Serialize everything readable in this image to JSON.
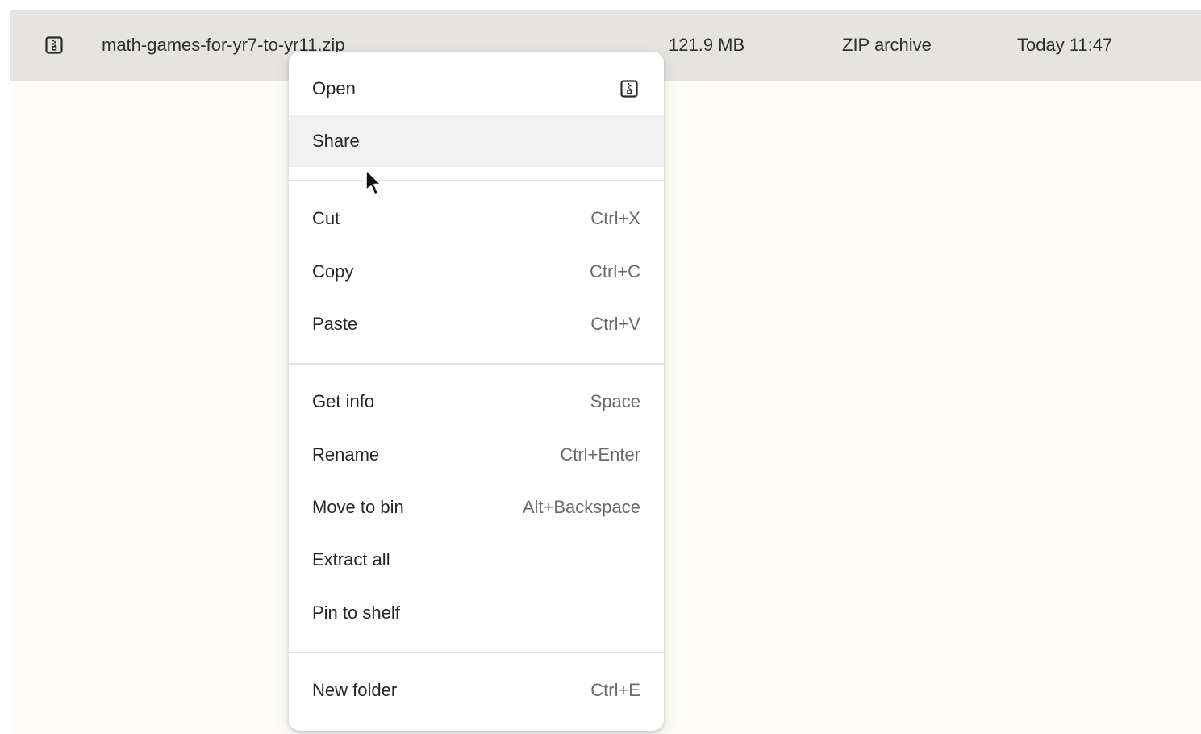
{
  "file_row": {
    "icon": "zip-file-icon",
    "name": "math-games-for-yr7-to-yr11.zip",
    "size": "121.9 MB",
    "type": "ZIP archive",
    "modified": "Today 11:47"
  },
  "context_menu": {
    "open": {
      "label": "Open",
      "icon": "zip-file-icon"
    },
    "share": {
      "label": "Share"
    },
    "cut": {
      "label": "Cut",
      "shortcut": "Ctrl+X"
    },
    "copy": {
      "label": "Copy",
      "shortcut": "Ctrl+C"
    },
    "paste": {
      "label": "Paste",
      "shortcut": "Ctrl+V"
    },
    "get_info": {
      "label": "Get info",
      "shortcut": "Space"
    },
    "rename": {
      "label": "Rename",
      "shortcut": "Ctrl+Enter"
    },
    "move_to_bin": {
      "label": "Move to bin",
      "shortcut": "Alt+Backspace"
    },
    "extract_all": {
      "label": "Extract all"
    },
    "pin_to_shelf": {
      "label": "Pin to shelf"
    },
    "new_folder": {
      "label": "New folder",
      "shortcut": "Ctrl+E"
    }
  },
  "colors": {
    "selected_row": "#e6e4e1",
    "hover_item": "#f1f1f1",
    "background": "#fdfcf9"
  }
}
